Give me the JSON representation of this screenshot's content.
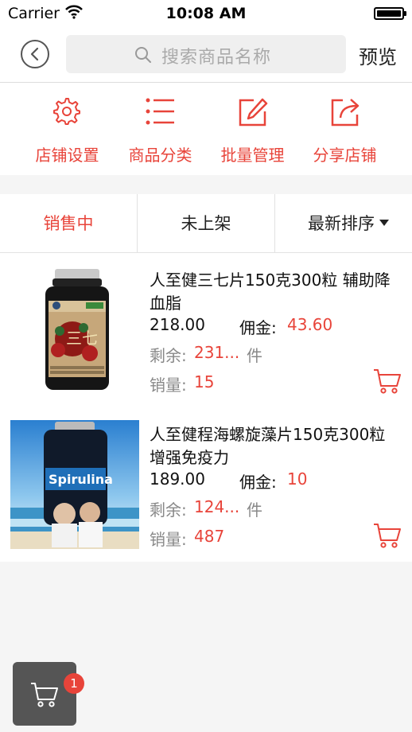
{
  "status_bar": {
    "carrier": "Carrier",
    "time": "10:08 AM"
  },
  "nav": {
    "search_placeholder": "搜索商品名称",
    "preview_label": "预览"
  },
  "toolbar": [
    {
      "label": "店铺设置",
      "icon": "gear-icon"
    },
    {
      "label": "商品分类",
      "icon": "list-icon"
    },
    {
      "label": "批量管理",
      "icon": "edit-icon"
    },
    {
      "label": "分享店铺",
      "icon": "share-icon"
    }
  ],
  "tabs": {
    "on_sale": "销售中",
    "off_shelf": "未上架",
    "sort": "最新排序"
  },
  "products": [
    {
      "title": "人至健三七片150克300粒 辅助降血脂",
      "price": "218.00",
      "commission_label": "佣金:",
      "commission_value": "43.60",
      "stock_label": "剩余:",
      "stock_value": "231...",
      "stock_unit": "件",
      "sales_label": "销量:",
      "sales_value": "15"
    },
    {
      "title": "人至健程海螺旋藻片150克300粒 增强免疫力",
      "price": "189.00",
      "commission_label": "佣金:",
      "commission_value": "10",
      "stock_label": "剩余:",
      "stock_value": "124...",
      "stock_unit": "件",
      "sales_label": "销量:",
      "sales_value": "487"
    }
  ],
  "float_cart": {
    "badge": "1"
  },
  "colors": {
    "accent": "#e8443a",
    "background": "#f5f5f5",
    "cart_bg": "#555555"
  }
}
